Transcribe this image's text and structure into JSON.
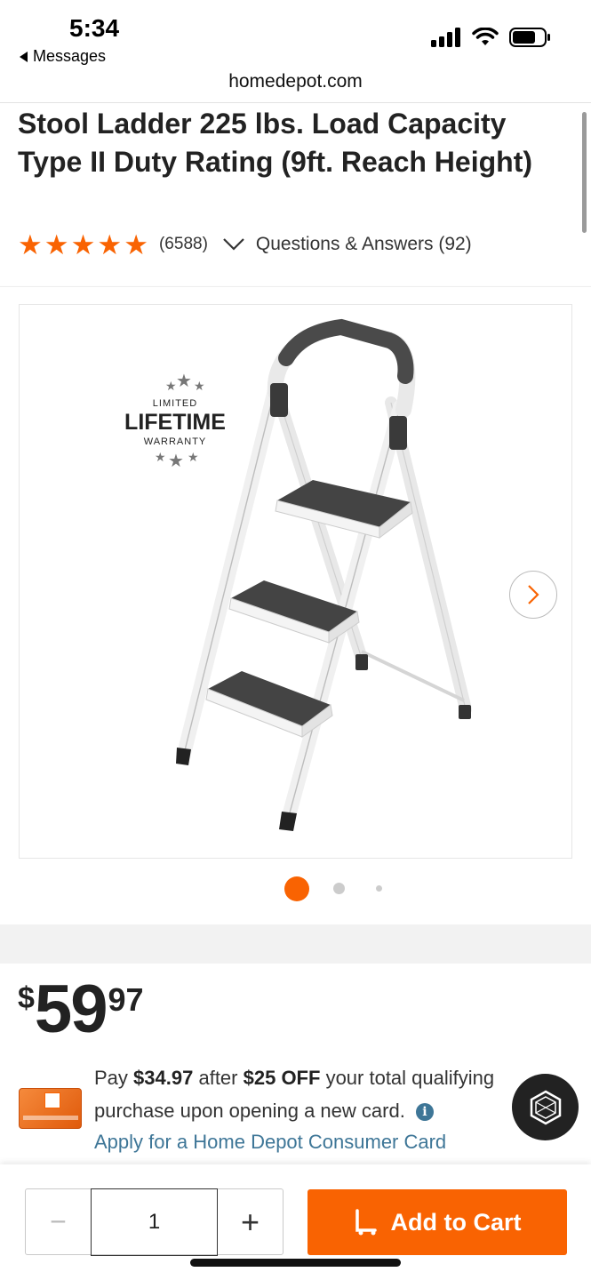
{
  "status_bar": {
    "time": "5:34",
    "back_label": "Messages",
    "icons": [
      "cellular-signal-icon",
      "wifi-icon",
      "battery-icon"
    ]
  },
  "browser": {
    "url": "homedepot.com"
  },
  "product": {
    "title": "Stool Ladder 225 lbs. Load Capacity Type II Duty Rating (9ft. Reach Height)",
    "rating": 5,
    "review_count": "(6588)",
    "qa_link": "Questions & Answers (92)"
  },
  "gallery": {
    "badge_top": "LIMITED",
    "badge_main": "LIFETIME",
    "badge_bottom": "WARRANTY",
    "image_count": 3,
    "active_index": 0
  },
  "pricing": {
    "currency": "$",
    "dollars": "59",
    "cents": "97"
  },
  "promo": {
    "pay_text": "Pay",
    "pay_amount": "$34.97",
    "after_text": "after",
    "discount": "$25 OFF",
    "rest_text": "your total qualifying purchase upon opening a new card.",
    "apply_link": "Apply for a Home Depot Consumer Card"
  },
  "cart": {
    "quantity": "1",
    "minus_label": "−",
    "plus_label": "+",
    "add_label": "Add to Cart"
  },
  "colors": {
    "brand_orange": "#f96302",
    "link_blue": "#3e7697"
  }
}
